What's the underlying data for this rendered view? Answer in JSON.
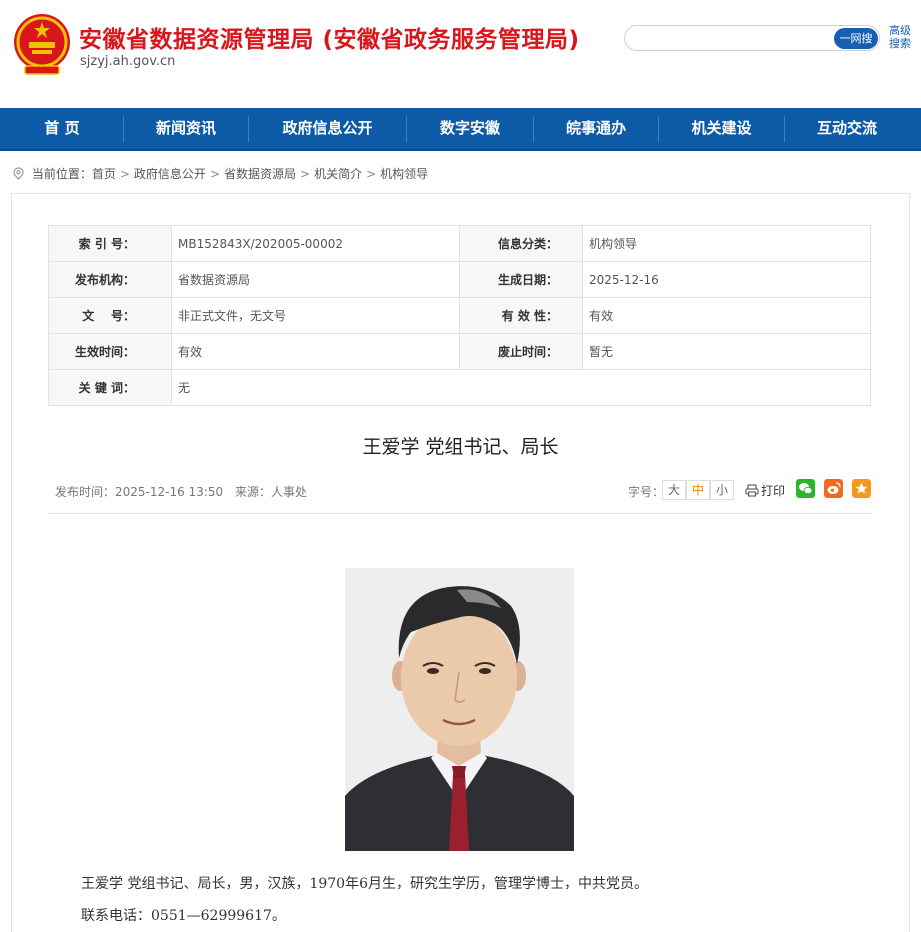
{
  "header": {
    "site_title": "安徽省数据资源管理局 (安徽省政务服务管理局)",
    "site_domain": "sjzyj.ah.gov.cn",
    "search_button": "一网搜",
    "advanced_search": "高级搜索",
    "emblem_icon": "national-emblem-icon",
    "brand_color": "#d9161c"
  },
  "nav": {
    "items": [
      "首 页",
      "新闻资讯",
      "政府信息公开",
      "数字安徽",
      "皖事通办",
      "机关建设",
      "互动交流"
    ],
    "background": "#0d5aa7"
  },
  "breadcrumb": {
    "prefix": "当前位置：",
    "items": [
      "首页",
      "政府信息公开",
      "省数据资源局",
      "机关简介",
      "机构领导"
    ],
    "separator": ">"
  },
  "info": {
    "index_label": "索 引 号：",
    "index_value": "MB152843X/202005-00002",
    "category_label": "信息分类：",
    "category_value": "机构领导",
    "publisher_label": "发布机构：",
    "publisher_value": "省数据资源局",
    "date_label": "生成日期：",
    "date_value": "2025-12-16",
    "docno_label": "文    号：",
    "docno_value": "非正式文件，无文号",
    "validity_label": "有 效 性：",
    "validity_value": "有效",
    "effective_label": "生效时间：",
    "effective_value": "有效",
    "expire_label": "废止时间：",
    "expire_value": "暂无",
    "keywords_label": "关 键 词：",
    "keywords_value": "无"
  },
  "article": {
    "title": "王爱学 党组书记、局长",
    "publish_time": "发布时间：2025-12-16 13:50",
    "source": "来源：人事处",
    "font_size_label": "字号：",
    "font_sizes": [
      "大",
      "中",
      "小"
    ],
    "print_label": "打印",
    "share_icons": [
      "wechat-icon",
      "weibo-icon",
      "favorite-icon"
    ],
    "paragraphs": [
      "王爱学 党组书记、局长，男，汉族，1970年6月生，研究生学历，管理学博士，中共党员。",
      "联系电话：0551—62999617。"
    ]
  }
}
